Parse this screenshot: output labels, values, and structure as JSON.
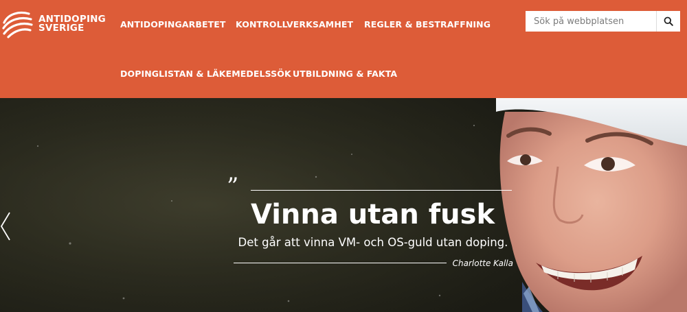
{
  "brand": {
    "line1": "ANTIDOPING",
    "line2": "SVERIGE",
    "logo_icon": "antidoping-sverige-logo-icon"
  },
  "nav": {
    "items": [
      {
        "label": "ANTIDOPINGARBETET"
      },
      {
        "label": "KONTROLLVERKSAMHET"
      },
      {
        "label": "REGLER & BESTRAFFNING"
      },
      {
        "label": "DOPINGLISTAN & LÄKEMEDELSSÖK"
      },
      {
        "label": "UTBILDNING & FAKTA"
      }
    ]
  },
  "search": {
    "placeholder": "Sök på webbplatsen",
    "value": "",
    "icon": "search-icon"
  },
  "hero": {
    "quote_mark": "”",
    "headline": "Vinna utan fusk",
    "subline": "Det går att vinna VM- och OS-guld utan doping.",
    "author": "Charlotte Kalla",
    "prev_icon": "chevron-left-icon"
  },
  "colors": {
    "brand_orange": "#dd5c38",
    "text_on_brand": "#ffffff",
    "hero_dark": "#2a2a1e"
  }
}
